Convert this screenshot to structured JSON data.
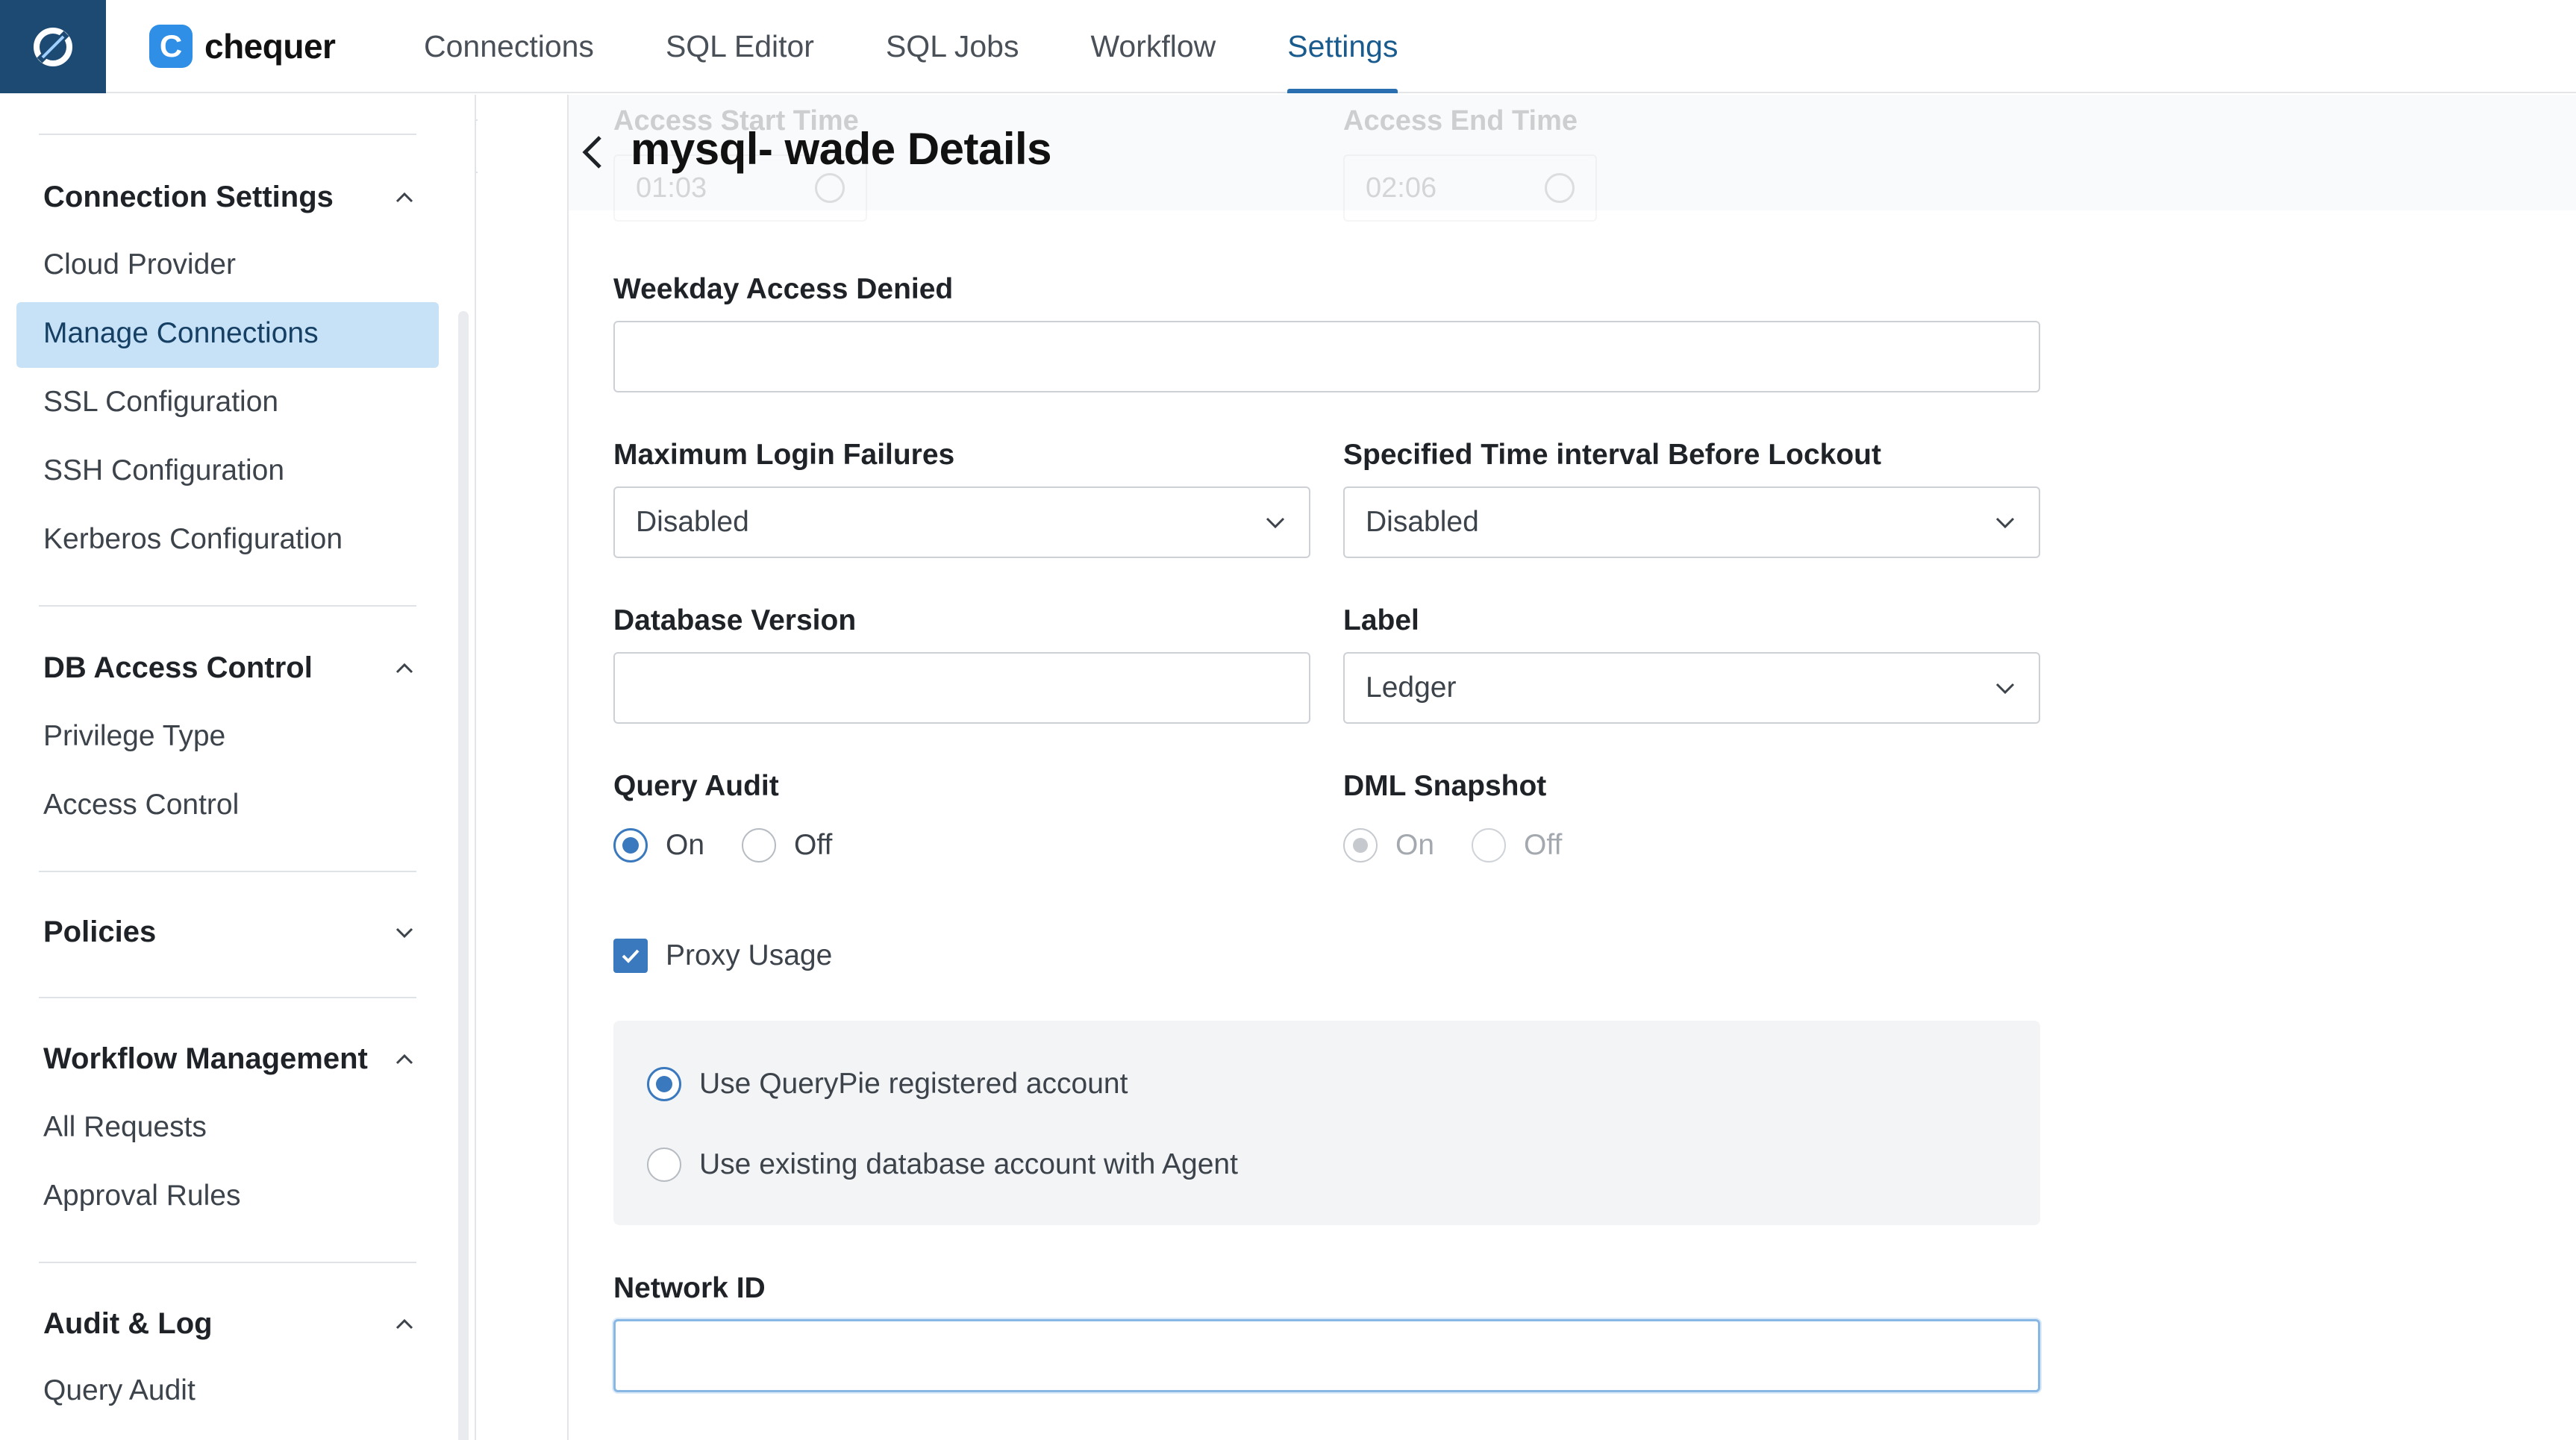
{
  "brand": {
    "name": "chequer",
    "mark": "C"
  },
  "nav": {
    "tabs": [
      {
        "label": "Connections"
      },
      {
        "label": "SQL Editor"
      },
      {
        "label": "SQL Jobs"
      },
      {
        "label": "Workflow"
      },
      {
        "label": "Settings",
        "active": true
      }
    ]
  },
  "sidebar": {
    "sections": [
      {
        "title": "Connection Settings",
        "expanded": true,
        "items": [
          "Cloud Provider",
          "Manage Connections",
          "SSL Configuration",
          "SSH Configuration",
          "Kerberos Configuration"
        ]
      },
      {
        "title": "DB Access Control",
        "expanded": true,
        "items": [
          "Privilege Type",
          "Access Control"
        ]
      },
      {
        "title": "Policies",
        "expanded": false,
        "items": []
      },
      {
        "title": "Workflow Management",
        "expanded": true,
        "items": [
          "All Requests",
          "Approval Rules"
        ]
      },
      {
        "title": "Audit & Log",
        "expanded": true,
        "items": [
          "Query Audit"
        ]
      }
    ],
    "active_item": "Manage Connections"
  },
  "page": {
    "title": "mysql- wade Details"
  },
  "faded_header": {
    "start_label": "Access Start Time",
    "start_value": "01:03",
    "end_label": "Access End Time",
    "end_value": "02:06"
  },
  "form": {
    "weekday_denied": {
      "label": "Weekday Access Denied",
      "value": ""
    },
    "max_login_failures": {
      "label": "Maximum Login Failures",
      "value": "Disabled"
    },
    "lockout_interval": {
      "label": "Specified Time interval Before Lockout",
      "value": "Disabled"
    },
    "db_version": {
      "label": "Database Version",
      "value": ""
    },
    "label_field": {
      "label": "Label",
      "value": "Ledger"
    },
    "query_audit": {
      "label": "Query Audit",
      "on": "On",
      "off": "Off",
      "selected": "On"
    },
    "dml_snapshot": {
      "label": "DML Snapshot",
      "on": "On",
      "off": "Off",
      "selected": "On",
      "disabled": true
    },
    "proxy_usage": {
      "label": "Proxy Usage",
      "checked": true
    },
    "proxy_options": {
      "registered": "Use QueryPie registered account",
      "existing": "Use existing database account with Agent",
      "selected": "registered"
    },
    "network_id": {
      "label": "Network ID",
      "value": ""
    }
  },
  "colors": {
    "accent": "#3a79bd",
    "app_icon_bg": "#1d4a73",
    "active_item_bg": "#c7e2f7"
  }
}
